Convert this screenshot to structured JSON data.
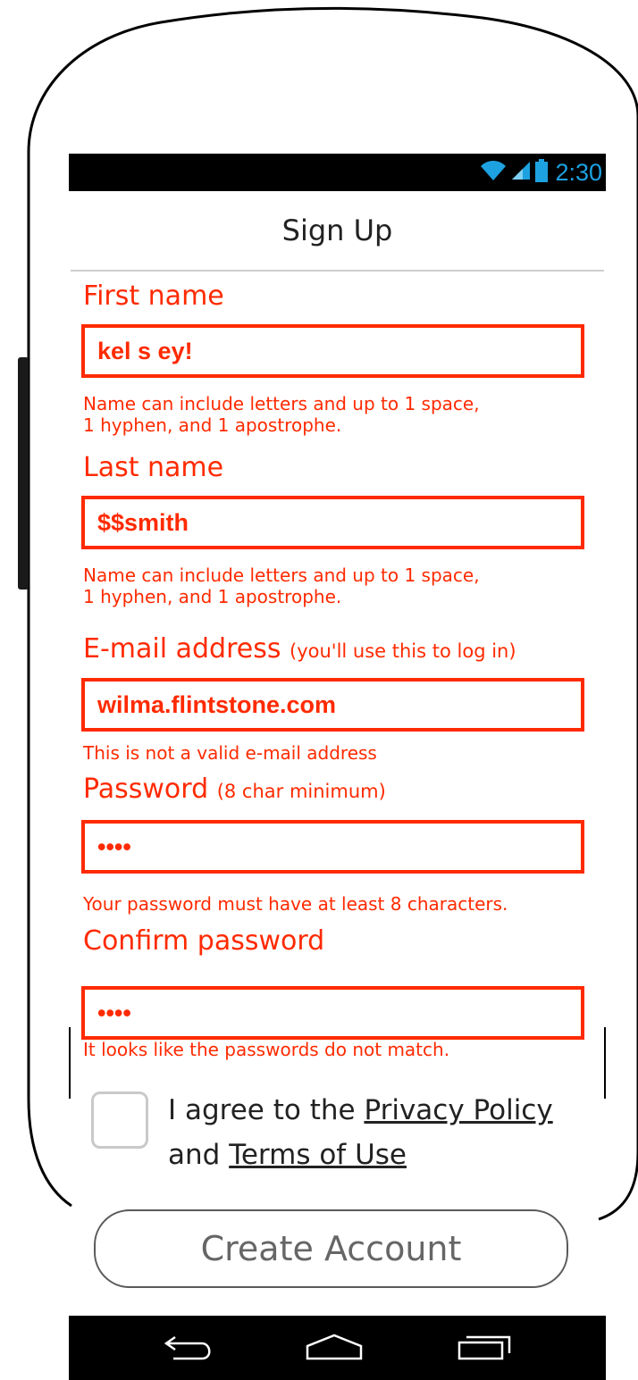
{
  "status_bar": {
    "time": "2:30",
    "icons": [
      "wifi-icon",
      "signal-icon",
      "battery-icon"
    ],
    "accent": "#1da1e0"
  },
  "header": {
    "title": "Sign Up"
  },
  "form": {
    "first_name": {
      "label": "First name",
      "value": "kel s ey!",
      "error": "Name can include letters and up to 1 space,\n1 hyphen, and 1 apostrophe."
    },
    "last_name": {
      "label": "Last name",
      "value": "$$smith",
      "error": "Name can include letters and up to 1 space,\n1 hyphen, and 1 apostrophe."
    },
    "email": {
      "label": "E-mail address",
      "hint": "(you'll use this to log in)",
      "value": "wilma.flintstone.com",
      "error": "This is not a valid e-mail address"
    },
    "password": {
      "label": "Password",
      "hint": "(8 char minimum)",
      "value": "••••",
      "error": "Your password must have at least 8 characters."
    },
    "confirm_password": {
      "label": "Confirm password",
      "value": "••••",
      "error": "It looks like the passwords do not match."
    },
    "error_color": "#ff2a00"
  },
  "agreement": {
    "prefix": "I agree to the ",
    "privacy_link": "Privacy Policy",
    "conjunction": "and ",
    "terms_link": "Terms of Use",
    "checked": false
  },
  "create_button": {
    "label": "Create Account"
  },
  "nav_bar": {
    "icons": [
      "back-icon",
      "home-icon",
      "recent-apps-icon"
    ]
  }
}
